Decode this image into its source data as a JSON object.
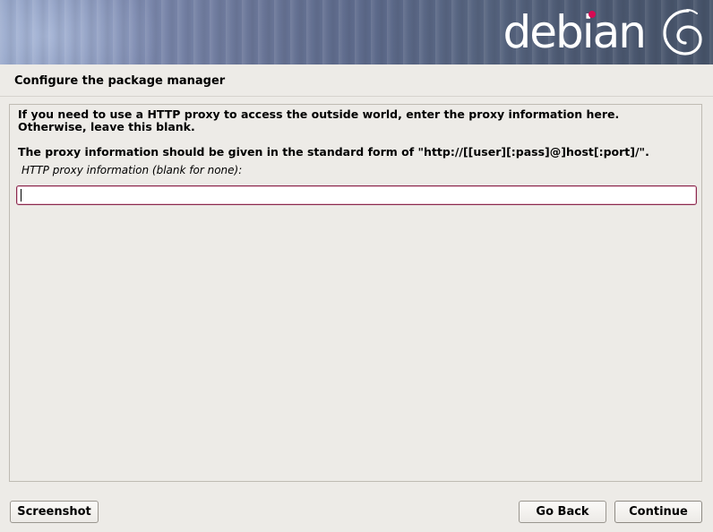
{
  "header": {
    "brand": "debian",
    "colors": {
      "brand_accent": "#d70a53"
    }
  },
  "page": {
    "title": "Configure the package manager"
  },
  "content": {
    "intro": "If you need to use a HTTP proxy to access the outside world, enter the proxy information here.\nOtherwise, leave this blank.",
    "format_hint": "The proxy information should be given in the standard form of \"http://[[user][:pass]@]host[:port]/\".",
    "field_label": "HTTP proxy information (blank for none):",
    "field_value": ""
  },
  "footer": {
    "screenshot_label": "Screenshot",
    "back_label": "Go Back",
    "continue_label": "Continue"
  },
  "icons": {
    "logo": "debian-swirl-icon"
  }
}
